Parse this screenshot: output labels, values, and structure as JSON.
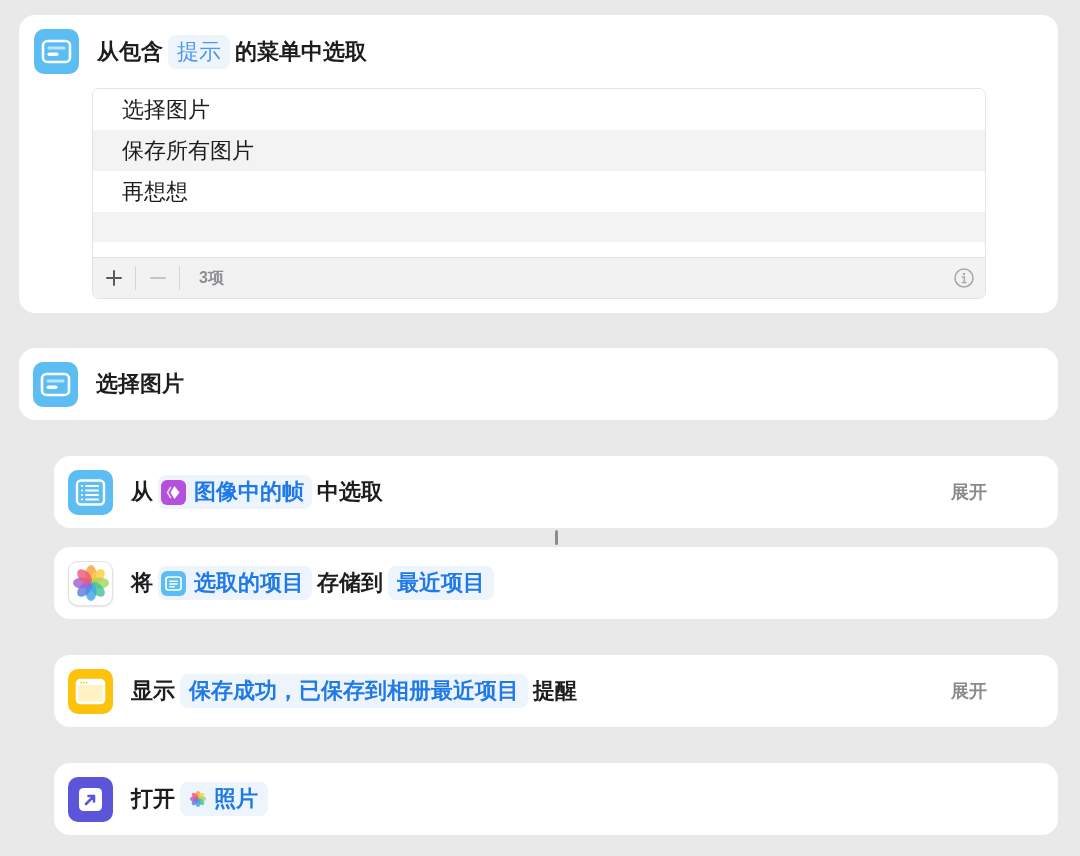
{
  "actions": [
    {
      "kind": "menu",
      "title": [
        {
          "kind": "text",
          "text": "从包含"
        },
        {
          "kind": "placeholder",
          "text": "提示"
        },
        {
          "kind": "text",
          "text": "的菜单中选取"
        }
      ],
      "items": [
        {
          "label": "选择图片"
        },
        {
          "label": "保存所有图片"
        },
        {
          "label": "再想想"
        }
      ],
      "footer": {
        "add_disabled": false,
        "remove_disabled": true,
        "count": "3项"
      }
    },
    {
      "kind": "case",
      "title": [
        {
          "kind": "text",
          "text": "选择图片"
        }
      ],
      "children": [
        {
          "kind": "list",
          "linked": true,
          "title": [
            {
              "kind": "text",
              "text": "从"
            },
            {
              "kind": "framevar",
              "text": "图像中的帧"
            },
            {
              "kind": "text",
              "text": "中选取"
            }
          ],
          "expand": "展开"
        },
        {
          "kind": "save",
          "linked": false,
          "title": [
            {
              "kind": "text",
              "text": "将"
            },
            {
              "kind": "listvar",
              "text": "选取的项目"
            },
            {
              "kind": "text",
              "text": "存储到"
            },
            {
              "kind": "token",
              "text": "最近项目"
            }
          ]
        },
        {
          "kind": "alert",
          "linked": false,
          "title": [
            {
              "kind": "text",
              "text": "显示"
            },
            {
              "kind": "token",
              "text": "保存成功，已保存到相册最近项目"
            },
            {
              "kind": "text",
              "text": "提醒"
            }
          ],
          "expand": "展开"
        },
        {
          "kind": "open",
          "linked": false,
          "title": [
            {
              "kind": "text",
              "text": "打开"
            },
            {
              "kind": "app",
              "text": "照片"
            }
          ]
        }
      ]
    }
  ]
}
